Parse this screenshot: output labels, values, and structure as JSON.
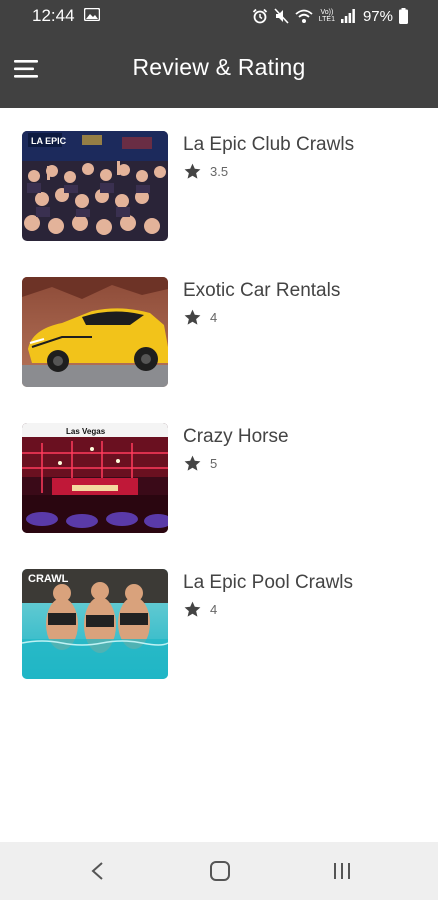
{
  "status_bar": {
    "time": "12:44",
    "network_top": "Vo))",
    "network_bottom": "LTE1",
    "battery": "97%"
  },
  "app_bar": {
    "title": "Review & Rating",
    "menu_icon": "hamburger-menu-icon"
  },
  "items": [
    {
      "title": "La Epic Club Crawls",
      "rating": "3.5",
      "thumb_caption": "LA EPIC"
    },
    {
      "title": "Exotic Car Rentals",
      "rating": "4",
      "thumb_caption": ""
    },
    {
      "title": "Crazy Horse",
      "rating": "5",
      "thumb_caption": "Las Vegas"
    },
    {
      "title": "La Epic Pool Crawls",
      "rating": "4",
      "thumb_caption": "CRAWL"
    }
  ],
  "nav_bar": {
    "back_icon": "back-chevron-icon",
    "home_icon": "home-square-icon",
    "recents_icon": "recents-bars-icon"
  },
  "colors": {
    "app_bar": "#414141",
    "nav_bar": "#efefef",
    "title_text": "#444444"
  }
}
